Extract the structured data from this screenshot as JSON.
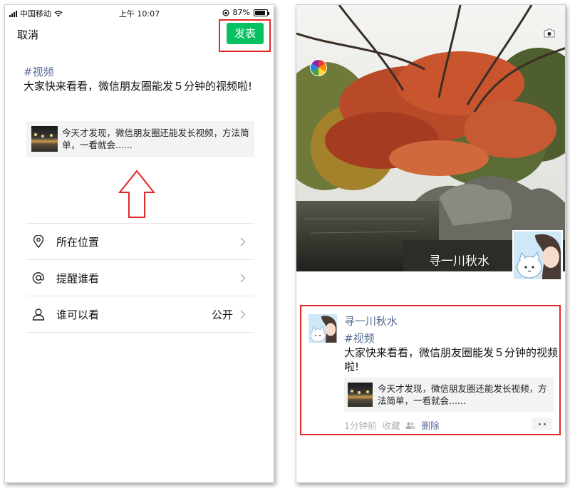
{
  "statusbar": {
    "carrier": "中国移动",
    "time": "上午 10:07",
    "battery": "87%",
    "battery_level": 0.87
  },
  "compose": {
    "cancel_label": "取消",
    "publish_label": "发表",
    "hashtag": "#视频",
    "text": "大家快来看看，微信朋友圈能发５分钟的视频啦!",
    "share_card_text": "今天才发现，微信朋友圈还能发长视频，方法简单，一看就会......"
  },
  "menu": {
    "items": [
      {
        "label": "所在位置",
        "value": "",
        "icon": "location-pin-icon"
      },
      {
        "label": "提醒谁看",
        "value": "",
        "icon": "at-sign-icon"
      },
      {
        "label": "谁可以看",
        "value": "公开",
        "icon": "person-icon"
      }
    ]
  },
  "moments": {
    "cover_name": "寻一川秋水",
    "post": {
      "author": "寻一川秋水",
      "hashtag": "#视频",
      "text": "大家快来看看，微信朋友圈能发５分钟的视频啦!",
      "share_card_text": "今天才发现，微信朋友圈还能发长视频，方法简单，一看就会......",
      "time_ago": "1分钟前",
      "favorite_label": "收藏",
      "delete_label": "删除"
    }
  },
  "colors": {
    "wechat_green": "#07c160",
    "link_blue": "#576b95",
    "highlight_red": "#e02828"
  }
}
